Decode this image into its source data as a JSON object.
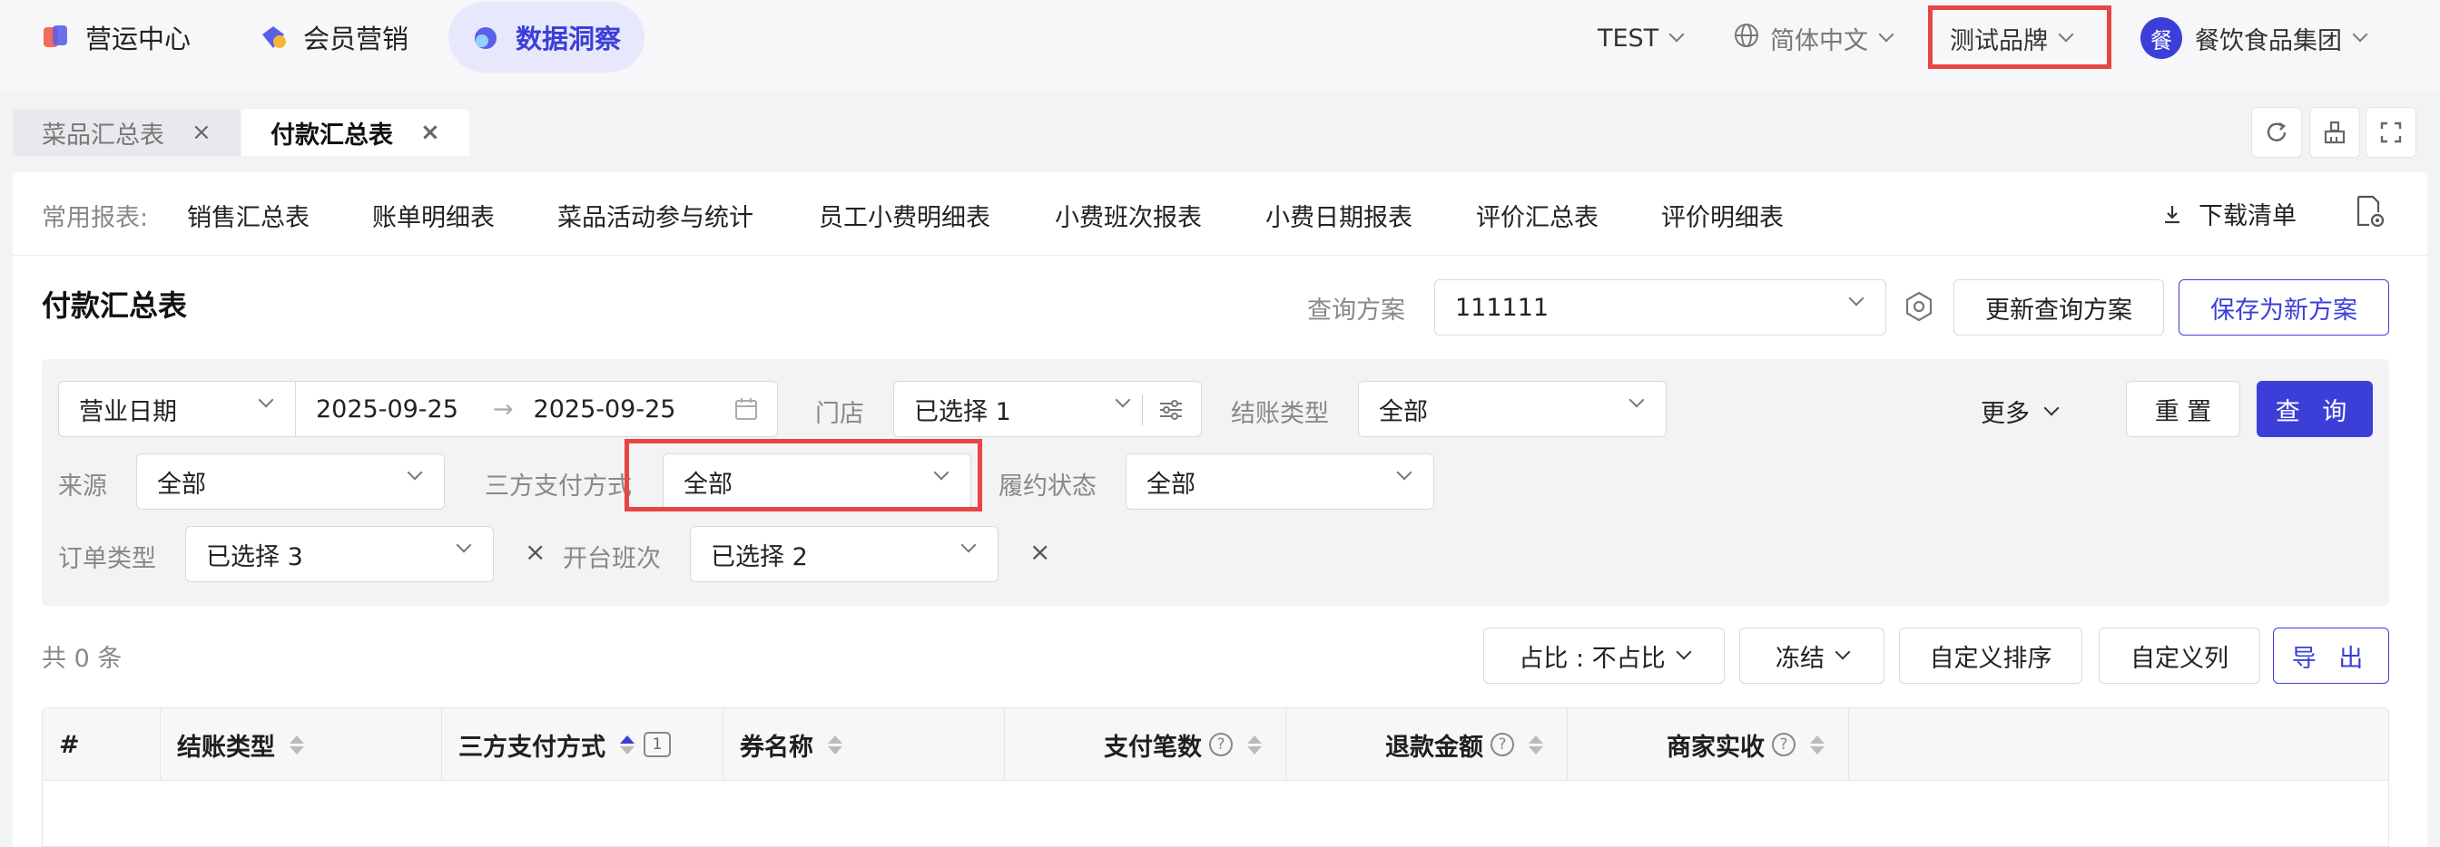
{
  "topnav": {
    "items": [
      {
        "label": "营运中心"
      },
      {
        "label": "会员营销"
      },
      {
        "label": "数据洞察"
      }
    ],
    "env": "TEST",
    "language": "简体中文",
    "brand": "测试品牌",
    "org_avatar": "餐",
    "org_name": "餐饮食品集团"
  },
  "tabs": [
    {
      "label": "菜品汇总表",
      "close": "×"
    },
    {
      "label": "付款汇总表",
      "close": "×"
    }
  ],
  "common_reports": {
    "label": "常用报表:",
    "links": [
      "销售汇总表",
      "账单明细表",
      "菜品活动参与统计",
      "员工小费明细表",
      "小费班次报表",
      "小费日期报表",
      "评价汇总表",
      "评价明细表"
    ],
    "download": "下载清单"
  },
  "page": {
    "title": "付款汇总表",
    "scheme_label": "查询方案",
    "scheme_value": "111111",
    "update_scheme": "更新查询方案",
    "save_scheme": "保存为新方案"
  },
  "filters": {
    "date_type": "营业日期",
    "date_start": "2025-09-25",
    "date_arrow": "→",
    "date_end": "2025-09-25",
    "store_label": "门店",
    "store_value": "已选择 1",
    "checkout_label": "结账类型",
    "checkout_value": "全部",
    "more": "更多",
    "reset": "重 置",
    "query": "查 询",
    "source_label": "来源",
    "source_value": "全部",
    "third_pay_label": "三方支付方式",
    "third_pay_value": "全部",
    "fulfill_label": "履约状态",
    "fulfill_value": "全部",
    "order_type_label": "订单类型",
    "order_type_value": "已选择 3",
    "shift_label": "开台班次",
    "shift_value": "已选择 2",
    "clear": "×"
  },
  "result": {
    "count_text": "共 0 条",
    "ratio": "占比 : 不占比",
    "freeze": "冻结",
    "custom_sort": "自定义排序",
    "custom_cols": "自定义列",
    "export": "导 出"
  },
  "table": {
    "columns": [
      {
        "label": "#"
      },
      {
        "label": "结账类型"
      },
      {
        "label": "三方支付方式",
        "sort_badge": "1"
      },
      {
        "label": "券名称"
      },
      {
        "label": "支付笔数",
        "help": "?"
      },
      {
        "label": "退款金额",
        "help": "?"
      },
      {
        "label": "商家实收",
        "help": "?"
      }
    ]
  }
}
